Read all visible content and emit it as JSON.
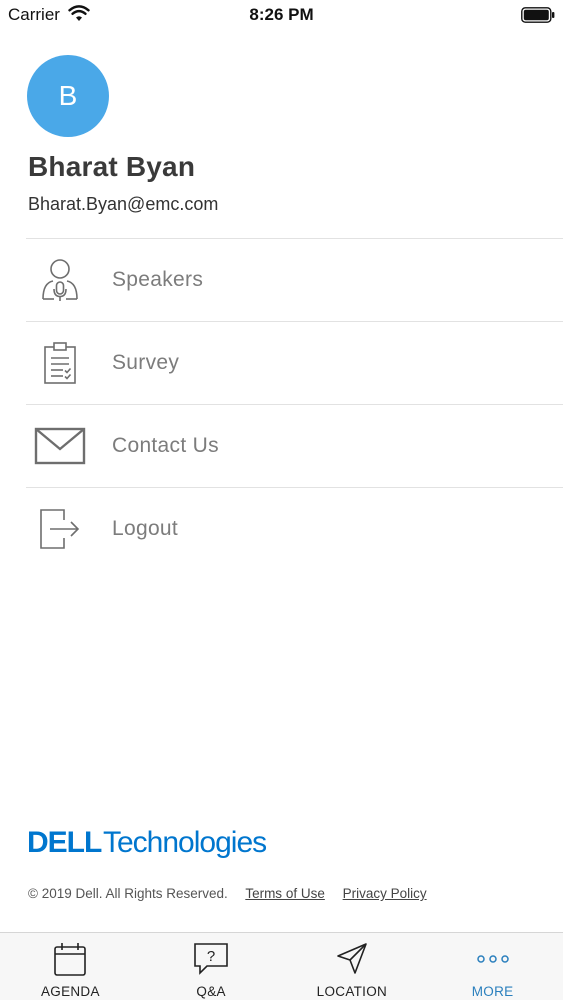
{
  "status_bar": {
    "carrier": "Carrier",
    "time": "8:26 PM"
  },
  "profile": {
    "initial": "B",
    "name": "Bharat Byan",
    "email": "Bharat.Byan@emc.com",
    "avatar_color": "#4aa8e8"
  },
  "menu": {
    "items": [
      {
        "label": "Speakers",
        "icon": "speaker-icon"
      },
      {
        "label": "Survey",
        "icon": "clipboard-icon"
      },
      {
        "label": "Contact Us",
        "icon": "envelope-icon"
      },
      {
        "label": "Logout",
        "icon": "logout-icon"
      }
    ]
  },
  "footer": {
    "logo_text": "DELLTechnologies",
    "copyright": "© 2019 Dell. All Rights Reserved.",
    "terms": "Terms of Use",
    "privacy": "Privacy Policy",
    "brand_color": "#0076ce"
  },
  "tab_bar": {
    "tabs": [
      {
        "label": "AGENDA",
        "icon": "calendar-icon"
      },
      {
        "label": "Q&A",
        "icon": "question-bubble-icon"
      },
      {
        "label": "LOCATION",
        "icon": "navigation-arrow-icon"
      },
      {
        "label": "MORE",
        "icon": "more-dots-icon",
        "active": true
      }
    ],
    "active_color": "#2a7fbd"
  }
}
